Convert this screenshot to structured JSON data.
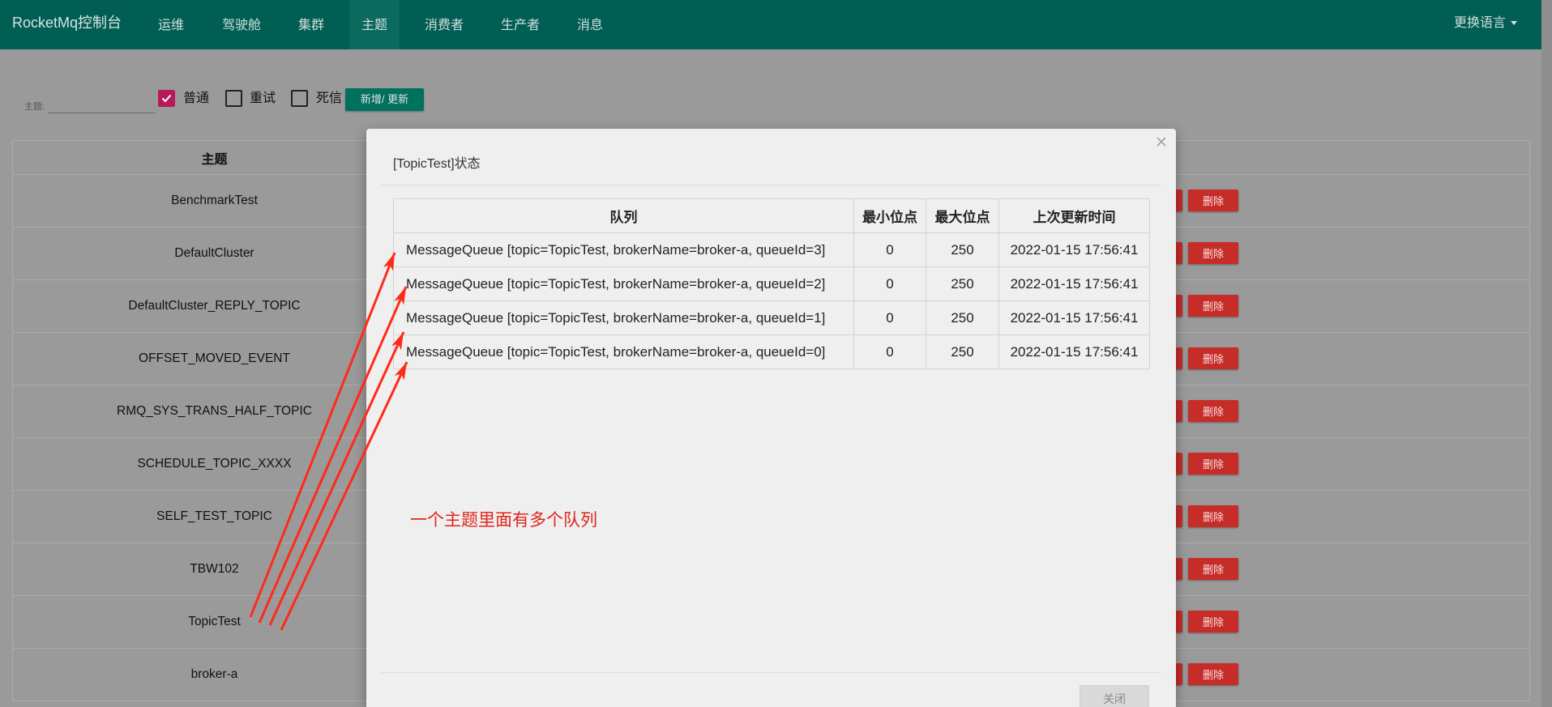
{
  "navbar": {
    "brand": "RocketMq控制台",
    "items": [
      {
        "label": "运维"
      },
      {
        "label": "驾驶舱"
      },
      {
        "label": "集群"
      },
      {
        "label": "主题",
        "active": true
      },
      {
        "label": "消费者"
      },
      {
        "label": "生产者"
      },
      {
        "label": "消息"
      }
    ],
    "language_menu": "更换语言"
  },
  "filter": {
    "topic_label": "主题:",
    "options": [
      {
        "label": "普通",
        "checked": true
      },
      {
        "label": "重试",
        "checked": false
      },
      {
        "label": "死信",
        "checked": false
      }
    ],
    "submit_label": "新增/ 更新"
  },
  "topic_table": {
    "header": "主题",
    "rows": [
      "BenchmarkTest",
      "DefaultCluster",
      "DefaultCluster_REPLY_TOPIC",
      "OFFSET_MOVED_EVENT",
      "RMQ_SYS_TRANS_HALF_TOPIC",
      "SCHEDULE_TOPIC_XXXX",
      "SELF_TEST_TOPIC",
      "TBW102",
      "TopicTest",
      "broker-a"
    ],
    "delete_label": "删除"
  },
  "status_modal": {
    "title": "[TopicTest]状态",
    "columns": [
      "队列",
      "最小位点",
      "最大位点",
      "上次更新时间"
    ],
    "rows": [
      {
        "queue": "MessageQueue [topic=TopicTest, brokerName=broker-a, queueId=3]",
        "min_offset": 0,
        "max_offset": 250,
        "last_update": "2022-01-15 17:56:41"
      },
      {
        "queue": "MessageQueue [topic=TopicTest, brokerName=broker-a, queueId=2]",
        "min_offset": 0,
        "max_offset": 250,
        "last_update": "2022-01-15 17:56:41"
      },
      {
        "queue": "MessageQueue [topic=TopicTest, brokerName=broker-a, queueId=1]",
        "min_offset": 0,
        "max_offset": 250,
        "last_update": "2022-01-15 17:56:41"
      },
      {
        "queue": "MessageQueue [topic=TopicTest, brokerName=broker-a, queueId=0]",
        "min_offset": 0,
        "max_offset": 250,
        "last_update": "2022-01-15 17:56:41"
      }
    ],
    "close_button": "关闭"
  },
  "annotation": {
    "text": "一个主题里面有多个队列"
  },
  "icons": {
    "modal_close": "close-icon",
    "language_caret": "caret-down-icon",
    "checkbox_check": "check-icon",
    "annotation_arrow": "arrow-icon"
  },
  "colors": {
    "navbar": "#005e54",
    "accent": "#00705f",
    "checkbox_checked": "#b8195a",
    "danger": "#c62c28",
    "annotation": "#ff2a1a"
  }
}
